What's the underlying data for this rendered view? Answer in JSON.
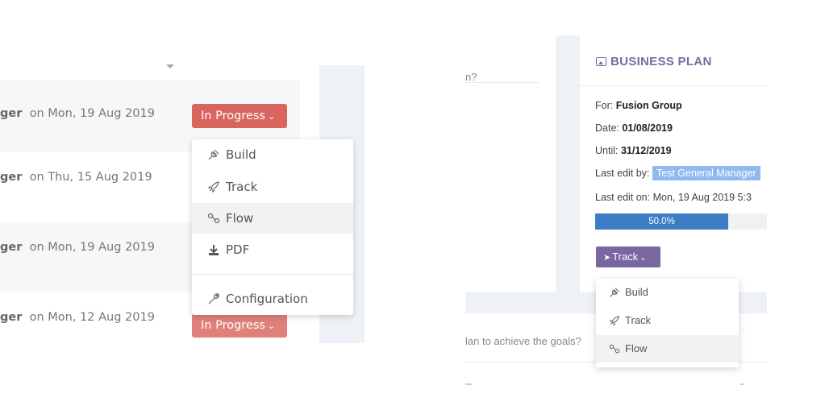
{
  "left": {
    "rows": [
      {
        "name": "ger",
        "date": "on Mon, 19 Aug 2019"
      },
      {
        "name": "ger",
        "date": "on Thu, 15 Aug 2019"
      },
      {
        "name": "ger",
        "date": "on Mon, 19 Aug 2019"
      },
      {
        "name": "ger",
        "date": "on Mon, 12 Aug 2019"
      }
    ],
    "status_label": "In Progress",
    "status_label_bottom": "In Progress",
    "dropdown": {
      "items": [
        "Build",
        "Track",
        "Flow",
        "PDF"
      ],
      "config": "Configuration"
    }
  },
  "right": {
    "question_fragment": "n?",
    "plan_fragment": "lan to achieve the goals?",
    "card": {
      "title": "BUSINESS PLAN",
      "for_label": "For:",
      "for_value": "Fusion Group",
      "date_label": "Date:",
      "date_value": "01/08/2019",
      "until_label": "Until:",
      "until_value": "31/12/2019",
      "last_edit_by_label": "Last edit by:",
      "last_edit_by_value": "Test General Manager",
      "last_edit_on": "Last edit on: Mon, 19 Aug 2019 5:3",
      "progress_text": "50.0%",
      "progress": 0.5,
      "progress_color": "#3b7ec4",
      "track_button": "Track"
    },
    "dropdown": {
      "items": [
        "Build",
        "Track",
        "Flow"
      ]
    }
  },
  "colors": {
    "status_red": "#d9655f",
    "plan_purple": "#7b6aa3",
    "badge_blue": "#8fb9ef"
  }
}
